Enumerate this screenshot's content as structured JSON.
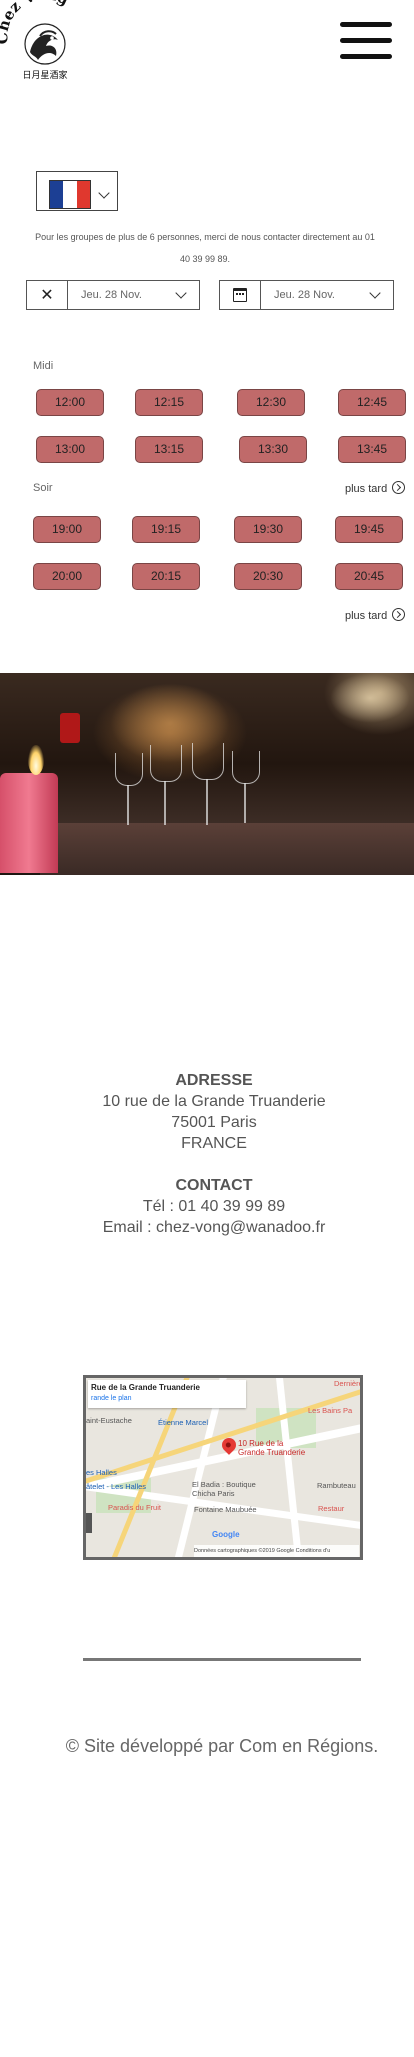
{
  "header": {
    "logo_text": "Chez Vong",
    "logo_subtitle": "日月星酒家"
  },
  "language": {
    "selected": "fr",
    "flag_colors": [
      "#1c3f94",
      "#ffffff",
      "#e0382e"
    ]
  },
  "booking": {
    "notice": "Pour les groupes de plus de 6 personnes, merci de nous contacter directement au 01 40 39 99 89.",
    "date_from": "Jeu. 28 Nov.",
    "date_to": "Jeu. 28 Nov.",
    "midi_label": "Midi",
    "soir_label": "Soir",
    "later_label": "plus tard",
    "slot_color": "#c06a6a",
    "midi_slots": [
      "12:00",
      "12:15",
      "12:30",
      "12:45",
      "13:00",
      "13:15",
      "13:30",
      "13:45"
    ],
    "soir_slots": [
      "19:00",
      "19:15",
      "19:30",
      "19:45",
      "20:00",
      "20:15",
      "20:30",
      "20:45"
    ]
  },
  "address": {
    "heading": "ADRESSE",
    "street": "10 rue de la Grande Truanderie",
    "city": "75001 Paris",
    "country": "FRANCE"
  },
  "contact": {
    "heading": "CONTACT",
    "phone": "Tél : 01 40 39 99 89",
    "email": "Email : chez-vong@wanadoo.fr"
  },
  "map": {
    "place_title": "Rue de la Grande Truanderie",
    "enlarge_link": "rande le plan",
    "pin_label": "10 Rue de la Grande Truanderie",
    "pois": {
      "derniere": "Dernière",
      "les_bains": "Les Bains Pa",
      "saint_eustache": "aint-Eustache",
      "etienne_marcel": "Étienne Marcel",
      "les_halles": "es Halles",
      "chatelet": "âtelet - Les Halles",
      "el_badia": "El Badia : Boutique Chicha Paris",
      "rambuteau": "Rambuteau",
      "paradis": "Paradis du Fruit",
      "fontaine": "Fontaine Maubuée",
      "restaurant": "Restaur"
    },
    "google_label": "Google",
    "footer": "Données cartographiques ©2019 Google   Conditions d'u"
  },
  "footer": {
    "credits": "© Site développé par Com en Régions."
  }
}
